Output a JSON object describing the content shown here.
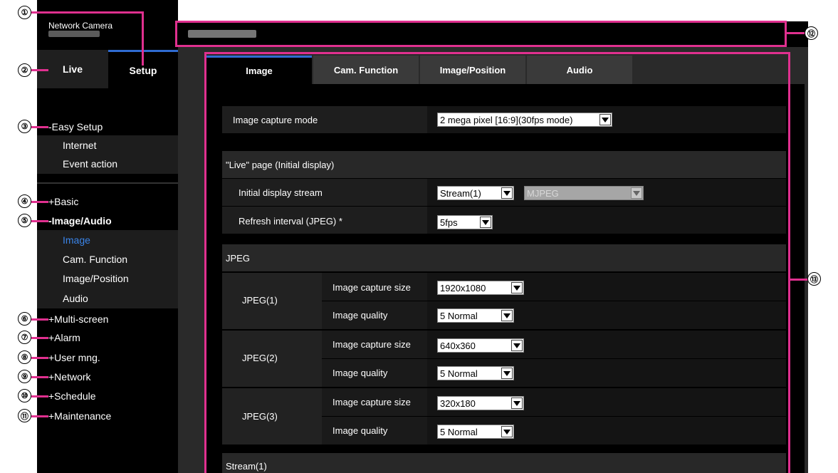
{
  "brand": {
    "title": "Network Camera"
  },
  "top_tabs": {
    "live": "Live",
    "setup": "Setup"
  },
  "sidebar": {
    "easy_setup": "-Easy Setup",
    "easy_items": [
      "Internet",
      "Event action"
    ],
    "basic": "+Basic",
    "image_audio": "-Image/Audio",
    "image_audio_items": [
      "Image",
      "Cam. Function",
      "Image/Position",
      "Audio"
    ],
    "multi_screen": "+Multi-screen",
    "alarm": "+Alarm",
    "user_mng": "+User mng.",
    "network": "+Network",
    "schedule": "+Schedule",
    "maintenance": "+Maintenance"
  },
  "main_tabs": [
    "Image",
    "Cam. Function",
    "Image/Position",
    "Audio"
  ],
  "form": {
    "capture_mode_label": "Image capture mode",
    "capture_mode_value": "2 mega pixel [16:9](30fps mode)",
    "live_section": "\"Live\" page (Initial display)",
    "initial_stream_label": "Initial display stream",
    "initial_stream_value": "Stream(1)",
    "initial_stream_format": "MJPEG",
    "refresh_label": "Refresh interval (JPEG) *",
    "refresh_value": "5fps",
    "jpeg_section": "JPEG",
    "jpeg_groups": [
      {
        "name": "JPEG(1)",
        "size_label": "Image capture size",
        "size_value": "1920x1080",
        "quality_label": "Image quality",
        "quality_value": "5 Normal"
      },
      {
        "name": "JPEG(2)",
        "size_label": "Image capture size",
        "size_value": "640x360",
        "quality_label": "Image quality",
        "quality_value": "5 Normal"
      },
      {
        "name": "JPEG(3)",
        "size_label": "Image capture size",
        "size_value": "320x180",
        "quality_label": "Image quality",
        "quality_value": "5 Normal"
      }
    ],
    "stream_section": "Stream(1)"
  },
  "callouts": [
    "①",
    "②",
    "③",
    "④",
    "⑤",
    "⑥",
    "⑦",
    "⑧",
    "⑨",
    "⑩",
    "⑪",
    "⑫",
    "⑬"
  ],
  "colors": {
    "annotation": "#e0308f",
    "active_blue": "#3a84e8",
    "tab_accent": "#2f6bd1"
  }
}
